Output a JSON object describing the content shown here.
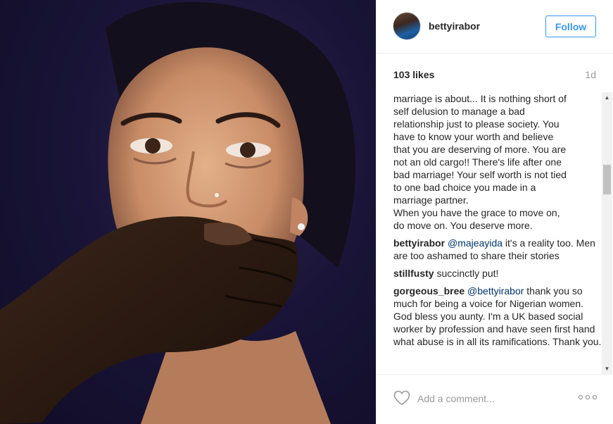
{
  "post": {
    "username": "bettyirabor",
    "follow_label": "Follow",
    "likes": "103 likes",
    "time": "1d"
  },
  "caption_lines": [
    "marriage is about... It is nothing short of",
    "self delusion to manage a bad",
    "relationship just to please society. You",
    "have to know your worth and believe",
    "that you are deserving of more. You are",
    "not an old cargo!! There's life after one",
    "bad marriage! Your self worth is not tied",
    "to one bad choice you made in a",
    "marriage partner.",
    "When you have the grace to move on,",
    "do move on. You deserve more."
  ],
  "comments": [
    {
      "user": "bettyirabor",
      "mention": "@majeayida",
      "text": " it's a reality too. Men are too ashamed to share their stories"
    },
    {
      "user": "stillfusty",
      "mention": "",
      "text": " succinctly put!"
    },
    {
      "user": "gorgeous_bree",
      "mention": "@bettyirabor",
      "text": " thank you so much for being a voice for Nigerian women. God bless you aunty. I'm a UK based social worker by profession and have seen first hand what abuse is in all its ramifications. Thank you."
    }
  ],
  "footer": {
    "comment_placeholder": "Add a comment..."
  },
  "icons": {
    "heart": "heart-icon",
    "more": "more-options-icon"
  },
  "colors": {
    "accent": "#3897f0",
    "mention": "#003569",
    "muted": "#999999"
  }
}
